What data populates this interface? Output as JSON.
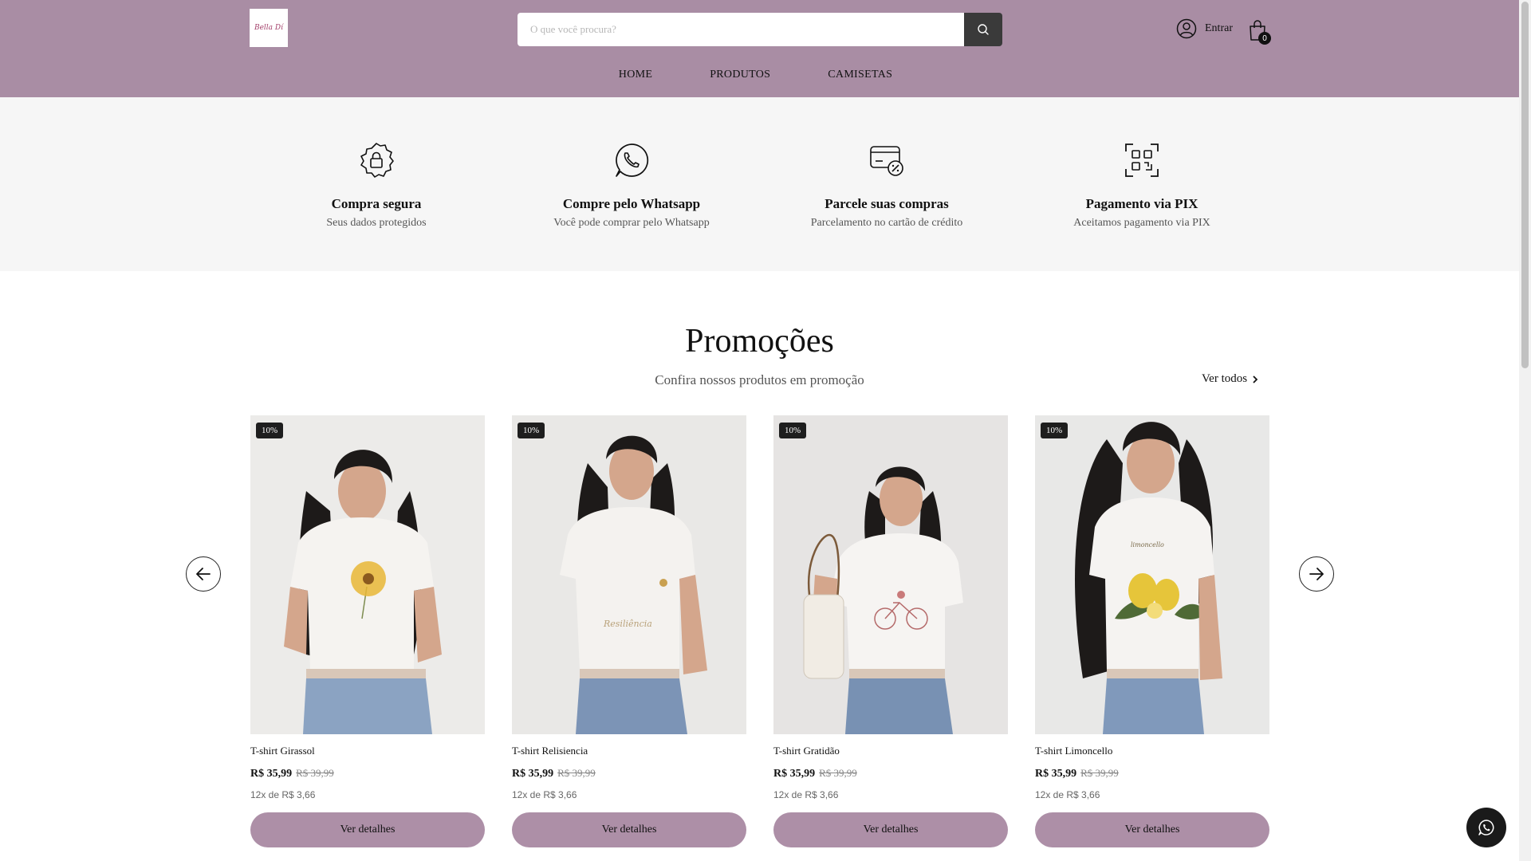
{
  "header": {
    "logo_text": "Bella Dí",
    "search_placeholder": "O que você procura?",
    "account_label": "Entrar",
    "cart_count": "0",
    "nav": [
      "HOME",
      "PRODUTOS",
      "CAMISETAS"
    ],
    "background_color": "#a98da4"
  },
  "benefits": [
    {
      "icon": "secure-lock-badge-icon",
      "title": "Compra segura",
      "subtitle": "Seus dados protegidos"
    },
    {
      "icon": "whatsapp-icon",
      "title": "Compre pelo Whatsapp",
      "subtitle": "Você pode comprar pelo Whatsapp"
    },
    {
      "icon": "card-percent-icon",
      "title": "Parcele suas compras",
      "subtitle": "Parcelamento no cartão de crédito"
    },
    {
      "icon": "pix-qr-icon",
      "title": "Pagamento via PIX",
      "subtitle": "Aceitamos pagamento via PIX"
    }
  ],
  "promotions": {
    "title": "Promoções",
    "subtitle": "Confira nossos produtos em promoção",
    "see_all": "Ver todos",
    "products": [
      {
        "badge": "10%",
        "name": "T-shirt Girassol",
        "price": "R$ 35,99",
        "old_price": "R$ 39,99",
        "installments": "12x de R$ 3,66",
        "button": "Ver detalhes",
        "print_color": "#e8b636"
      },
      {
        "badge": "10%",
        "name": "T-shirt Relisiencia",
        "price": "R$ 35,99",
        "old_price": "R$ 39,99",
        "installments": "12x de R$ 3,66",
        "button": "Ver detalhes",
        "print_color": "#c9a050"
      },
      {
        "badge": "10%",
        "name": "T-shirt Gratidão",
        "price": "R$ 35,99",
        "old_price": "R$ 39,99",
        "installments": "12x de R$ 3,66",
        "button": "Ver detalhes",
        "print_color": "#c97a7a"
      },
      {
        "badge": "10%",
        "name": "T-shirt Limoncello",
        "price": "R$ 35,99",
        "old_price": "R$ 39,99",
        "installments": "12x de R$ 3,66",
        "button": "Ver detalhes",
        "print_color": "#e6c53a"
      }
    ]
  },
  "colors": {
    "accent": "#ad8fa7",
    "badge": "#1e1e1e",
    "floating_button": "#1a1a1a"
  }
}
